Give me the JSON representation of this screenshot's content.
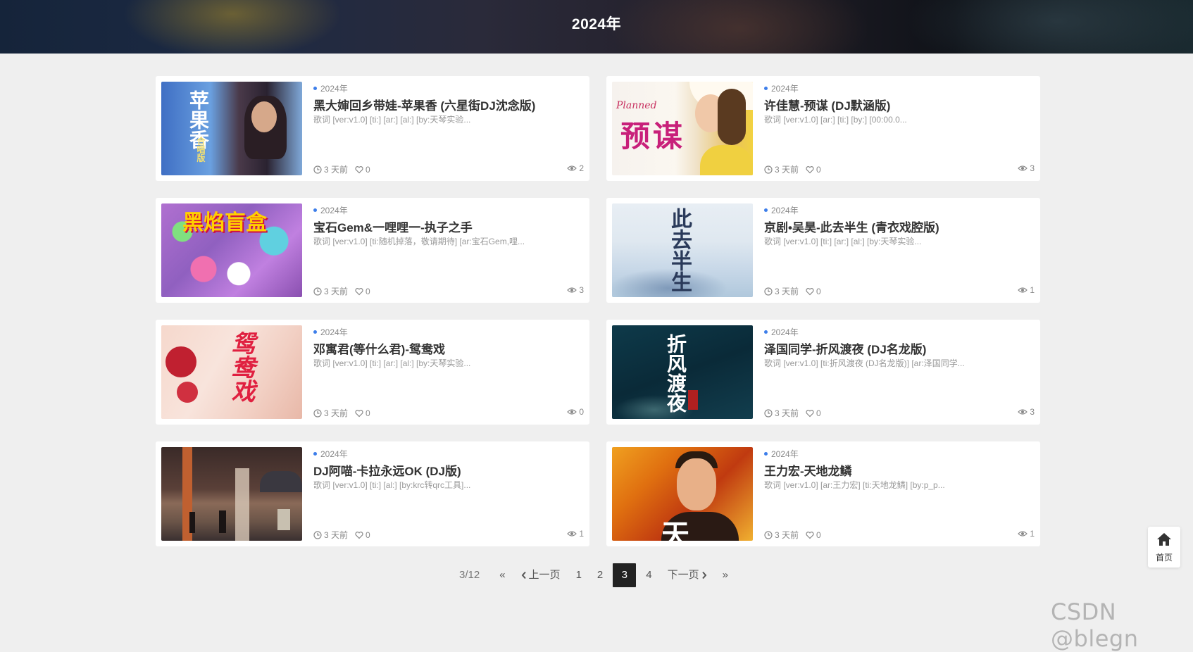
{
  "header": {
    "title": "2024年"
  },
  "posts": [
    {
      "category": "2024年",
      "title": "黑大婶回乡带娃-苹果香 (六星街DJ沈念版)",
      "excerpt": "歌词 [ver:v1.0] [ti:] [ar:] [al:] [by:天琴实验...",
      "time": "3 天前",
      "likes": "0",
      "views": "2",
      "thumb_text": "苹果香",
      "thumb_subtext": "合唱版"
    },
    {
      "category": "2024年",
      "title": "许佳慧-预谋 (DJ默涵版)",
      "excerpt": "歌词 [ver:v1.0] [ar:] [ti:] [by:] [00:00.0...",
      "time": "3 天前",
      "likes": "0",
      "views": "3",
      "thumb_text": "预谋",
      "thumb_subtext": "Planned"
    },
    {
      "category": "2024年",
      "title": "宝石Gem&一哩哩一-执子之手",
      "excerpt": "歌词 [ver:v1.0] [ti:随机掉落，敬请期待] [ar:宝石Gem,哩...",
      "time": "3 天前",
      "likes": "0",
      "views": "3",
      "thumb_text": "黑焰盲盒"
    },
    {
      "category": "2024年",
      "title": "京剧•吴昊-此去半生 (青衣戏腔版)",
      "excerpt": "歌词 [ver:v1.0] [ti:] [ar:] [al:] [by:天琴实验...",
      "time": "3 天前",
      "likes": "0",
      "views": "1",
      "thumb_text": "此去半生"
    },
    {
      "category": "2024年",
      "title": "邓寓君(等什么君)-鸳鸯戏",
      "excerpt": "歌词 [ver:v1.0] [ti:] [ar:] [al:] [by:天琴实验...",
      "time": "3 天前",
      "likes": "0",
      "views": "0",
      "thumb_text": "鸳鸯戏"
    },
    {
      "category": "2024年",
      "title": "泽国同学-折风渡夜 (DJ名龙版)",
      "excerpt": "歌词 [ver:v1.0] [ti:折风渡夜 (DJ名龙版)] [ar:泽国同学...",
      "time": "3 天前",
      "likes": "0",
      "views": "3",
      "thumb_text": "折风渡夜"
    },
    {
      "category": "2024年",
      "title": "DJ阿喵-卡拉永远OK (DJ版)",
      "excerpt": "歌词 [ver:v1.0] [ti:] [al:] [by:krc转qrc工具]...",
      "time": "3 天前",
      "likes": "0",
      "views": "1",
      "thumb_text": ""
    },
    {
      "category": "2024年",
      "title": "王力宏-天地龙鳞",
      "excerpt": "歌词 [ver:v1.0] [ar:王力宏] [ti:天地龙鳞] [by:p_p...",
      "time": "3 天前",
      "likes": "0",
      "views": "1",
      "thumb_text": "天"
    }
  ],
  "pagination": {
    "counter": "3/12",
    "first": "«",
    "prev": "上一页",
    "pages": [
      "1",
      "2",
      "3",
      "4"
    ],
    "current": "3",
    "next": "下一页",
    "last": "»"
  },
  "home_button": {
    "label": "首页"
  },
  "watermark": "CSDN @blegn",
  "icons": {
    "clock": "clock-icon",
    "heart": "heart-icon",
    "eye": "eye-icon",
    "home": "home-icon"
  },
  "colors": {
    "accent_dot": "#3d7eea",
    "active_page": "#222222",
    "background": "#efefef"
  }
}
